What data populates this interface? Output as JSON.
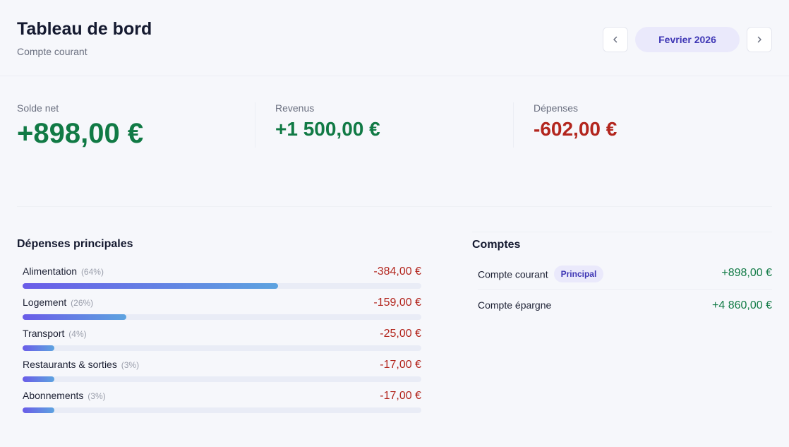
{
  "header": {
    "title": "Tableau de bord",
    "subtitle": "Compte courant",
    "month_label": "Fevrier 2026"
  },
  "icons": {
    "prev": "chevron-left-icon",
    "next": "chevron-right-icon"
  },
  "stats": [
    {
      "label": "Solde net",
      "value": "+898,00 €",
      "tone": "positive"
    },
    {
      "label": "Revenus",
      "value": "+1 500,00 €",
      "tone": "positive"
    },
    {
      "label": "Dépenses",
      "value": "-602,00 €",
      "tone": "negative"
    }
  ],
  "expenses": {
    "title": "Dépenses principales",
    "items": [
      {
        "name": "Alimentation",
        "pct": "(64%)",
        "amount": "-384,00 €",
        "share": 64
      },
      {
        "name": "Logement",
        "pct": "(26%)",
        "amount": "-159,00 €",
        "share": 26
      },
      {
        "name": "Transport",
        "pct": "(4%)",
        "amount": "-25,00 €",
        "share": 4
      },
      {
        "name": "Restaurants & sorties",
        "pct": "(3%)",
        "amount": "-17,00 €",
        "share": 3
      },
      {
        "name": "Abonnements",
        "pct": "(3%)",
        "amount": "-17,00 €",
        "share": 3
      }
    ]
  },
  "accounts": {
    "title": "Comptes",
    "items": [
      {
        "name": "Compte courant",
        "badge": "Principal",
        "amount": "+898,00 €"
      },
      {
        "name": "Compte épargne",
        "badge": "",
        "amount": "+4 860,00 €"
      }
    ]
  },
  "colors": {
    "positive": "#117a45",
    "negative": "#b3261e",
    "accent": "#3f37b5",
    "accent_bg": "#eae9fb"
  }
}
